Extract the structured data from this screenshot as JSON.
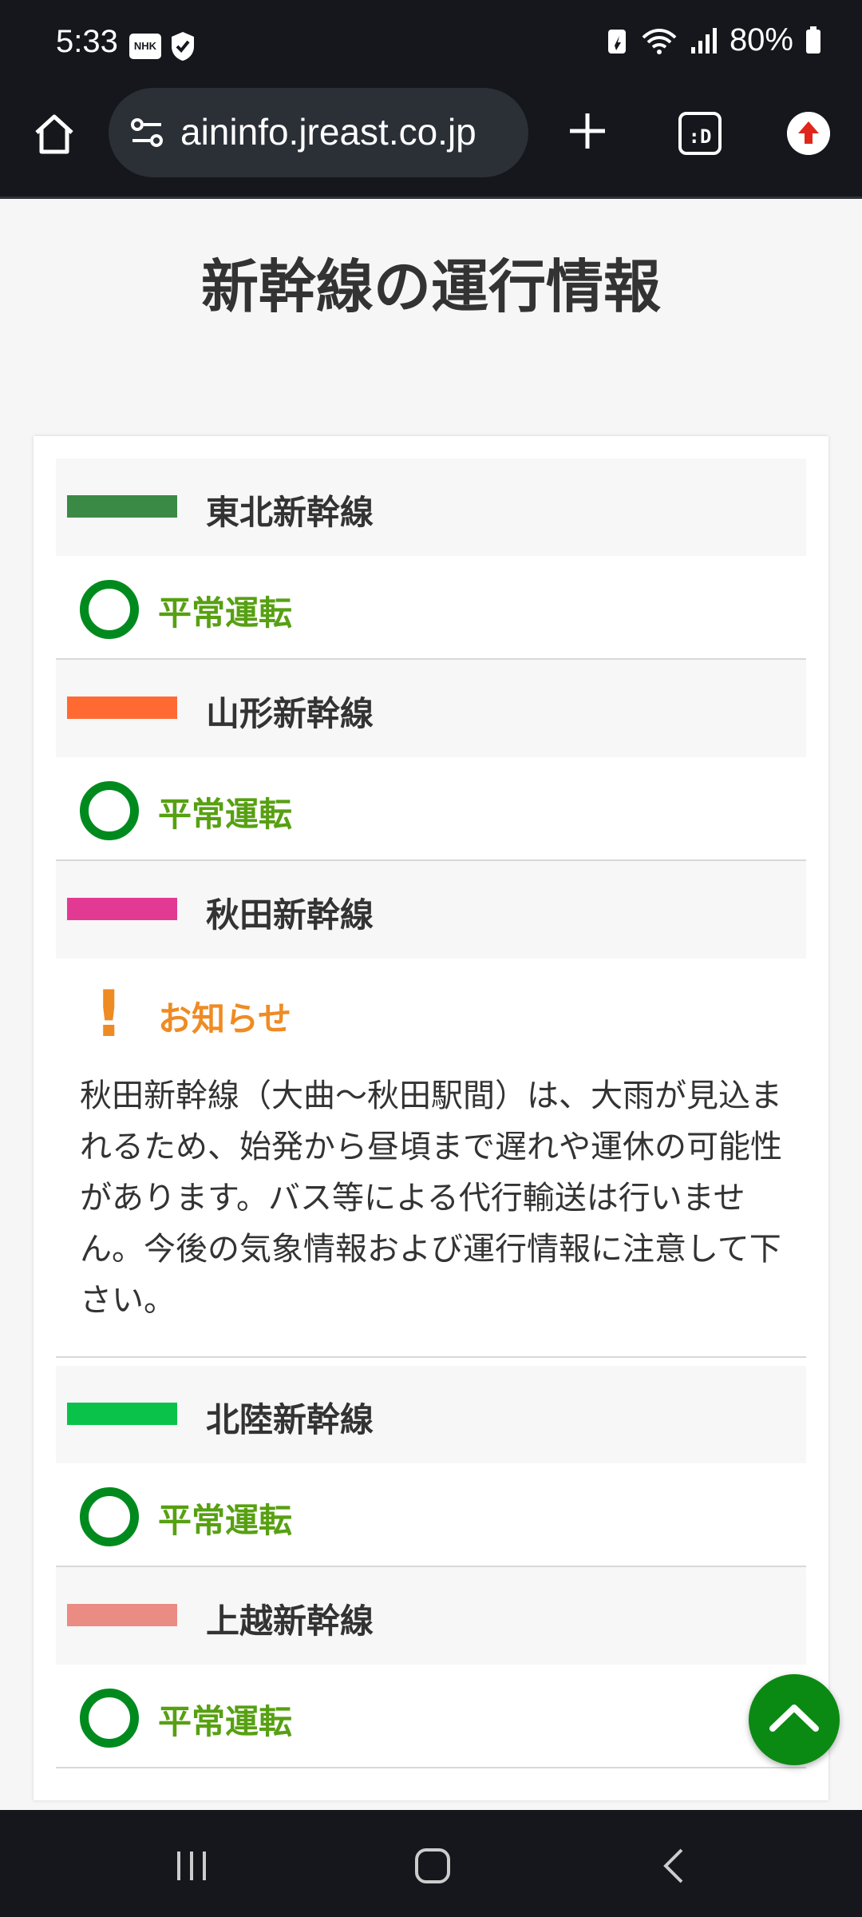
{
  "status_bar": {
    "time": "5:33",
    "notification_badge": "NHK",
    "battery": "80%"
  },
  "browser": {
    "url": "aininfo.jreast.co.jp",
    "tab_button_label": ":D"
  },
  "page": {
    "title": "新幹線の運行情報"
  },
  "lines": [
    {
      "name": "東北新幹線",
      "color": "#3a8a45",
      "status": "平常運転"
    },
    {
      "name": "山形新幹線",
      "color": "#ff6a33",
      "status": "平常運転"
    },
    {
      "name": "秋田新幹線",
      "color": "#e23a93",
      "notice_label": "お知らせ",
      "notice_text": "秋田新幹線（大曲〜秋田駅間）は、大雨が見込まれるため、始発から昼頃まで遅れや運休の可能性があります。バス等による代行輸送は行いません。今後の気象情報および運行情報に注意して下さい。"
    },
    {
      "name": "北陸新幹線",
      "color": "#0ac24a",
      "status": "平常運転"
    },
    {
      "name": "上越新幹線",
      "color": "#ea8b84",
      "status": "平常運転"
    }
  ],
  "colors": {
    "normal_status": "#57a012",
    "normal_circle": "#008a1e",
    "notice": "#ef8b23",
    "fab": "#0a8a13"
  },
  "icons": {
    "home": "home-icon",
    "site_settings": "tune-icon",
    "new_tab": "plus-icon",
    "update": "update-arrow-icon",
    "scroll_top": "chevron-up-icon"
  }
}
